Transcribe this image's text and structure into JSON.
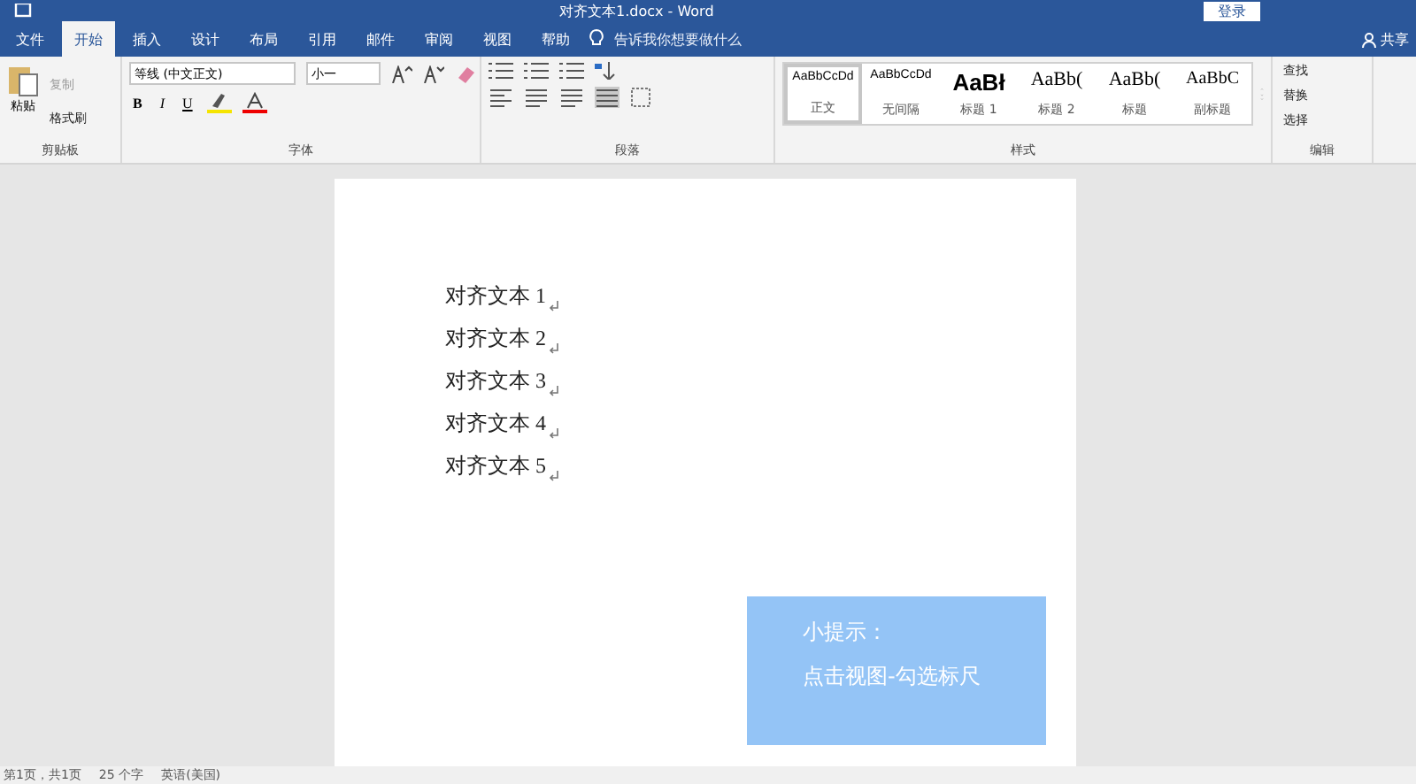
{
  "window": {
    "title": "对齐文本1.docx - Word",
    "login": "登录",
    "share": "共享"
  },
  "tabs": [
    {
      "label": "文件",
      "selected": false
    },
    {
      "label": "开始",
      "selected": true
    },
    {
      "label": "插入",
      "selected": false
    },
    {
      "label": "设计",
      "selected": false
    },
    {
      "label": "布局",
      "selected": false
    },
    {
      "label": "引用",
      "selected": false
    },
    {
      "label": "邮件",
      "selected": false
    },
    {
      "label": "审阅",
      "selected": false
    },
    {
      "label": "视图",
      "selected": false
    },
    {
      "label": "帮助",
      "selected": false
    }
  ],
  "tell_me": {
    "placeholder": "告诉我你想要做什么"
  },
  "clipboard": {
    "paste": "粘贴",
    "copy": "复制",
    "format_painter": "格式刷",
    "label": "剪贴板"
  },
  "font": {
    "name": "等线 (中文正文)",
    "size": "小一",
    "label": "字体",
    "bold": "B",
    "italic": "I",
    "underline": "U"
  },
  "paragraph": {
    "label": "段落"
  },
  "styles": {
    "label": "样式",
    "items": [
      {
        "preview": "AaBbCcDd",
        "name": "正文",
        "kind": "normal",
        "selected": true
      },
      {
        "preview": "AaBbCcDd",
        "name": "无间隔",
        "kind": "normal",
        "selected": false
      },
      {
        "preview": "AaBł",
        "name": "标题 1",
        "kind": "heading1",
        "selected": false
      },
      {
        "preview": "AaBb(",
        "name": "标题 2",
        "kind": "heading2",
        "selected": false
      },
      {
        "preview": "AaBb(",
        "name": "标题",
        "kind": "title",
        "selected": false
      },
      {
        "preview": "AaBbC",
        "name": "副标题",
        "kind": "subtitle",
        "selected": false
      }
    ]
  },
  "editing": {
    "label": "编辑",
    "find": "查找",
    "replace": "替换",
    "select": "选择"
  },
  "document": {
    "lines": [
      "对齐文本 1",
      "对齐文本 2",
      "对齐文本 3",
      "对齐文本 4",
      "对齐文本 5"
    ]
  },
  "tip": {
    "title": "小提示：",
    "text": "点击视图-勾选标尺"
  },
  "status_bar": {
    "page": "第1页，共1页",
    "words": "25 个字",
    "language": "英语(美国)"
  }
}
